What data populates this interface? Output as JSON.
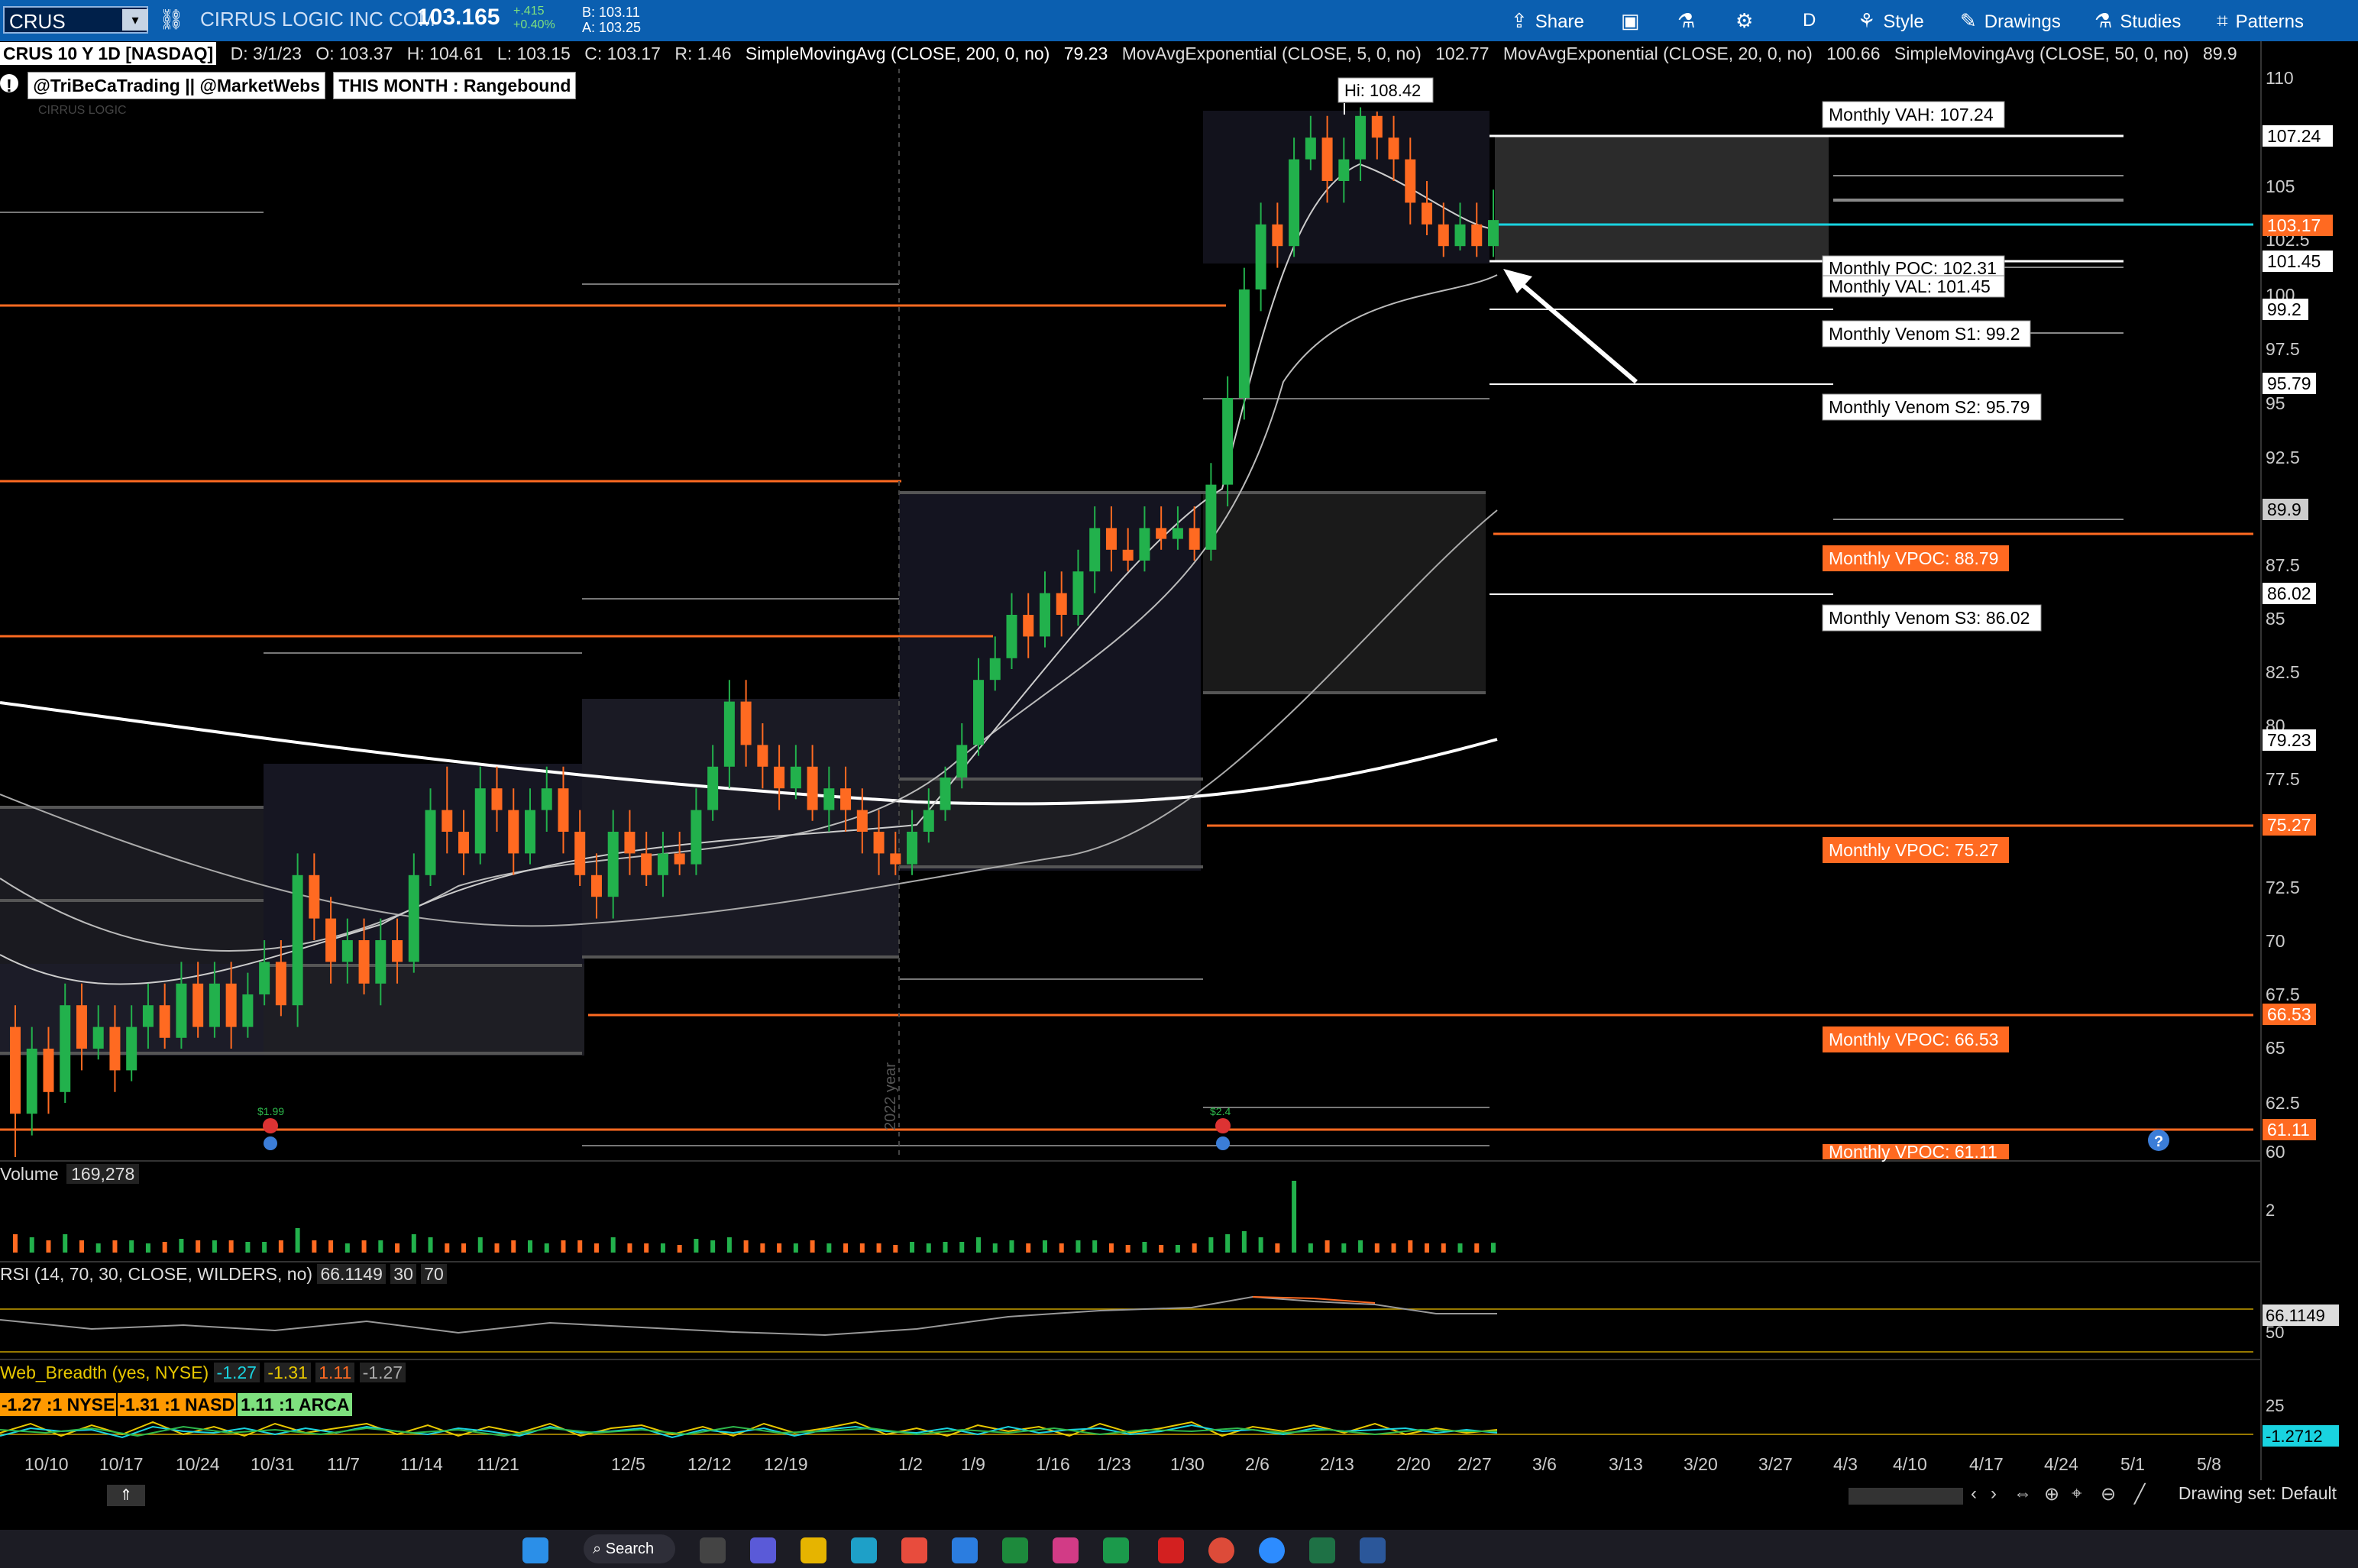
{
  "toolbar": {
    "symbol": "CRUS",
    "company": "CIRRUS LOGIC INC COM",
    "last": "103.165",
    "change": "+.415",
    "change_pct": "+0.40%",
    "bid": "B: 103.11",
    "ask": "A: 103.25",
    "buttons": {
      "share": "Share",
      "period": "D",
      "style": "Style",
      "drawings": "Drawings",
      "studies": "Studies",
      "patterns": "Patterns"
    }
  },
  "info": {
    "chart_title": "CRUS 10 Y 1D [NASDAQ]",
    "date": "D: 3/1/23",
    "open": "O: 103.37",
    "high": "H: 104.61",
    "low": "L: 103.15",
    "close": "C: 103.17",
    "range": "R: 1.46",
    "sma200": "SimpleMovingAvg (CLOSE, 200, 0, no)",
    "sma200_val": "79.23",
    "ema5": "MovAvgExponential (CLOSE, 5, 0, no)",
    "ema5_val": "102.77",
    "ema20": "MovAvgExponential (CLOSE, 20, 0, no)",
    "ema20_val": "100.66",
    "sma50": "SimpleMovingAvg (CLOSE, 50, 0, no)",
    "sma50_val": "89.9"
  },
  "study_tags": {
    "handles": "@TriBeCaTrading || @MarketWebs",
    "month_state": "THIS MONTH : Rangebound",
    "watermark": "CIRRUS LOGIC"
  },
  "hi_label": "Hi: 108.42",
  "annotations": [
    {
      "text": "Monthly VAH: 107.24",
      "kind": "white"
    },
    {
      "text": "Monthly POC: 102.31",
      "kind": "white"
    },
    {
      "text": "Monthly VAL: 101.45",
      "kind": "white"
    },
    {
      "text": "Monthly Venom S1: 99.2",
      "kind": "white"
    },
    {
      "text": "Monthly Venom S2: 95.79",
      "kind": "white"
    },
    {
      "text": "Monthly VPOC: 88.79",
      "kind": "orange"
    },
    {
      "text": "Monthly Venom S3: 86.02",
      "kind": "white"
    },
    {
      "text": "Monthly VPOC: 75.27",
      "kind": "orange"
    },
    {
      "text": "Monthly VPOC: 66.53",
      "kind": "orange"
    },
    {
      "text": "Monthly VPOC: 61.11",
      "kind": "orange"
    }
  ],
  "right_axis_ticks": [
    "110",
    "105",
    "102.5",
    "100",
    "97.5",
    "95",
    "92.5",
    "87.5",
    "85",
    "82.5",
    "80",
    "77.5",
    "72.5",
    "70",
    "67.5",
    "65",
    "62.5",
    "60"
  ],
  "right_axis_tags": [
    {
      "text": "107.24",
      "style": "white"
    },
    {
      "text": "103.17",
      "style": "orange"
    },
    {
      "text": "101.45",
      "style": "white"
    },
    {
      "text": "99.2",
      "style": "white"
    },
    {
      "text": "95.79",
      "style": "white"
    },
    {
      "text": "89.9",
      "style": "gray"
    },
    {
      "text": "86.02",
      "style": "white"
    },
    {
      "text": "79.23",
      "style": "white"
    },
    {
      "text": "75.27",
      "style": "orange"
    },
    {
      "text": "66.53",
      "style": "orange"
    },
    {
      "text": "61.11",
      "style": "orange"
    }
  ],
  "dividend_labels": [
    "$1.99",
    "$2.4"
  ],
  "year_label": "2022 year",
  "volume": {
    "label": "Volume",
    "value": "169,278",
    "axis": "2"
  },
  "rsi": {
    "label": "RSI (14, 70, 30, CLOSE, WILDERS, no)",
    "value": "66.1149",
    "os": "30",
    "ob": "70",
    "axis_tag": "66.1149",
    "axis": "50"
  },
  "breadth": {
    "label": "Web_Breadth (yes, NYSE)",
    "v1": "-1.27",
    "v2": "-1.31",
    "v3": "1.11",
    "v4": "-1.27",
    "nyse": "-1.27 :1 NYSE",
    "nasd": "-1.31 :1 NASD",
    "arca": "1.11 :1 ARCA",
    "axis": "25",
    "axis_tag": "-1.2712"
  },
  "x_axis": [
    "10/10",
    "10/17",
    "10/24",
    "10/31",
    "11/7",
    "11/14",
    "11/21",
    "12/5",
    "12/12",
    "12/19",
    "1/2",
    "1/9",
    "1/16",
    "1/23",
    "1/30",
    "2/6",
    "2/13",
    "2/20",
    "2/27",
    "3/6",
    "3/13",
    "3/20",
    "3/27",
    "4/3",
    "4/10",
    "4/17",
    "4/24",
    "5/1",
    "5/8"
  ],
  "drawing_set": "Drawing set: Default",
  "taskbar": {
    "search": "Search"
  },
  "colors": {
    "up": "#22b14c",
    "down": "#ff6a21",
    "vpoc": "#ff6a21",
    "cyan": "#19d3e0",
    "topbar": "#0b5fb0"
  },
  "chart_data": {
    "type": "candlestick",
    "ylim": [
      60,
      110
    ],
    "candles": [
      [
        66,
        62,
        67,
        60
      ],
      [
        62,
        65,
        66,
        61
      ],
      [
        65,
        63,
        66,
        62
      ],
      [
        63,
        67,
        68,
        62.5
      ],
      [
        67,
        65,
        68,
        64
      ],
      [
        65,
        66,
        67,
        64.5
      ],
      [
        66,
        64,
        67,
        63
      ],
      [
        64,
        66,
        67,
        63.5
      ],
      [
        66,
        67,
        68,
        65
      ],
      [
        67,
        65.5,
        68,
        65
      ],
      [
        65.5,
        68,
        69,
        65
      ],
      [
        68,
        66,
        69,
        65.5
      ],
      [
        66,
        68,
        69,
        65.5
      ],
      [
        68,
        66,
        69,
        65
      ],
      [
        66,
        67.5,
        68.5,
        65.5
      ],
      [
        67.5,
        69,
        70,
        67
      ],
      [
        69,
        67,
        70,
        66.5
      ],
      [
        67,
        73,
        74,
        66
      ],
      [
        73,
        71,
        74,
        70
      ],
      [
        71,
        69,
        72,
        68
      ],
      [
        69,
        70,
        71,
        68
      ],
      [
        70,
        68,
        71,
        67.5
      ],
      [
        68,
        70,
        71,
        67
      ],
      [
        70,
        69,
        71,
        68
      ],
      [
        69,
        73,
        74,
        68.5
      ],
      [
        73,
        76,
        77,
        72.5
      ],
      [
        76,
        75,
        78,
        74
      ],
      [
        75,
        74,
        76,
        73
      ],
      [
        74,
        77,
        78,
        73.5
      ],
      [
        77,
        76,
        78,
        75
      ],
      [
        76,
        74,
        77,
        73
      ],
      [
        74,
        76,
        77,
        73.5
      ],
      [
        76,
        77,
        78,
        75
      ],
      [
        77,
        75,
        78,
        74
      ],
      [
        75,
        73,
        76,
        72.5
      ],
      [
        73,
        72,
        74,
        71
      ],
      [
        72,
        75,
        76,
        71
      ],
      [
        75,
        74,
        76,
        73
      ],
      [
        74,
        73,
        75,
        72.5
      ],
      [
        73,
        74,
        75,
        72
      ],
      [
        74,
        73.5,
        75,
        73
      ],
      [
        73.5,
        76,
        77,
        73
      ],
      [
        76,
        78,
        79,
        75.5
      ],
      [
        78,
        81,
        82,
        77
      ],
      [
        81,
        79,
        82,
        78
      ],
      [
        79,
        78,
        80,
        77
      ],
      [
        78,
        77,
        79,
        76
      ],
      [
        77,
        78,
        79,
        76.5
      ],
      [
        78,
        76,
        79,
        75.5
      ],
      [
        76,
        77,
        78,
        75
      ],
      [
        77,
        76,
        78,
        75
      ],
      [
        76,
        75,
        77,
        74
      ],
      [
        75,
        74,
        76,
        73
      ],
      [
        74,
        73.5,
        75,
        73
      ],
      [
        73.5,
        75,
        76,
        73
      ],
      [
        75,
        76,
        77,
        74.5
      ],
      [
        76,
        77.5,
        78,
        75.5
      ],
      [
        77.5,
        79,
        80,
        77
      ],
      [
        79,
        82,
        83,
        78.5
      ],
      [
        82,
        83,
        84,
        81.5
      ],
      [
        83,
        85,
        86,
        82.5
      ],
      [
        85,
        84,
        86,
        83
      ],
      [
        84,
        86,
        87,
        83.5
      ],
      [
        86,
        85,
        87,
        84
      ],
      [
        85,
        87,
        88,
        84.5
      ],
      [
        87,
        89,
        90,
        86
      ],
      [
        89,
        88,
        90,
        87
      ],
      [
        88,
        87.5,
        89,
        87
      ],
      [
        87.5,
        89,
        90,
        87
      ],
      [
        89,
        88.5,
        90,
        88
      ],
      [
        88.5,
        89,
        90,
        88
      ],
      [
        89,
        88,
        90,
        87.5
      ],
      [
        88,
        91,
        92,
        87.5
      ],
      [
        91,
        95,
        96,
        90
      ],
      [
        95,
        100,
        101,
        94
      ],
      [
        100,
        103,
        104,
        99
      ],
      [
        103,
        102,
        104,
        101
      ],
      [
        102,
        106,
        107,
        101.5
      ],
      [
        106,
        107,
        108,
        105.5
      ],
      [
        107,
        105,
        108,
        104
      ],
      [
        105,
        106,
        107,
        104
      ],
      [
        106,
        108,
        108.4,
        105
      ],
      [
        108,
        107,
        108.2,
        106
      ],
      [
        107,
        106,
        108,
        105
      ],
      [
        106,
        104,
        107,
        103
      ],
      [
        104,
        103,
        105,
        102.5
      ],
      [
        103,
        102,
        104,
        101.5
      ],
      [
        102,
        103,
        104,
        101.8
      ],
      [
        103,
        102,
        104,
        101.5
      ],
      [
        102,
        103.2,
        104.6,
        101.5
      ]
    ]
  }
}
